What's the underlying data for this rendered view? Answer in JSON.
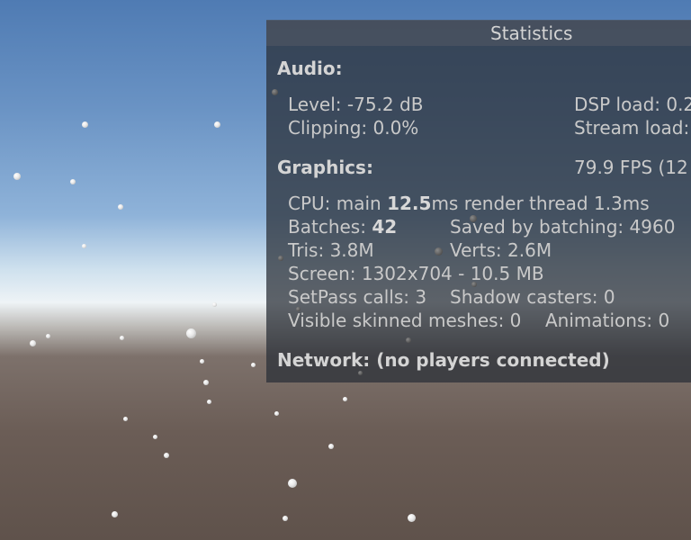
{
  "panel": {
    "title": "Statistics"
  },
  "audio": {
    "heading": "Audio:",
    "level": "Level: -75.2 dB",
    "dsp_load": "DSP load: 0.2",
    "clipping": "Clipping: 0.0%",
    "stream_load": "Stream load:"
  },
  "graphics": {
    "heading": "Graphics:",
    "fps": "79.9 FPS (12",
    "cpu_prefix": "CPU: main ",
    "cpu_main_value": "12.5",
    "cpu_suffix": "ms  render thread 1.3ms",
    "batches_label": "Batches: ",
    "batches_value": "42",
    "saved_by_batching": "Saved by batching: 4960",
    "tris": "Tris: 3.8M",
    "verts": "Verts: 2.6M",
    "screen": "Screen: 1302x704 - 10.5 MB",
    "setpass": "SetPass calls: 3",
    "shadow_casters": "Shadow casters: 0",
    "visible_skinned": "Visible skinned meshes: 0",
    "animations": "Animations: 0"
  },
  "network": {
    "status": "Network: (no players connected)"
  },
  "colors": {
    "sky_top": "#4f7bb3",
    "horizon": "#eef3f6",
    "ground": "#5f524b",
    "panel_text": "#c9c9c9"
  }
}
